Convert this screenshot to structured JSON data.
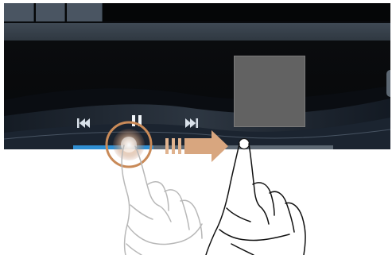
{
  "player": {
    "tabs": [
      "",
      "",
      ""
    ],
    "controls": [
      "previous-track",
      "pause",
      "next-track"
    ],
    "progress_fraction": 0.31
  },
  "gesture": {
    "type": "drag-seekbar",
    "direction": "right"
  },
  "colors": {
    "screen_bg": "#080a0c",
    "toolbar": "#3a444e",
    "progress_track": "#5d6873",
    "progress_fill": "#2f8fd3",
    "touch_ring": "#c98a58",
    "arrow": "#d8a67f",
    "album_art": "#626262"
  }
}
